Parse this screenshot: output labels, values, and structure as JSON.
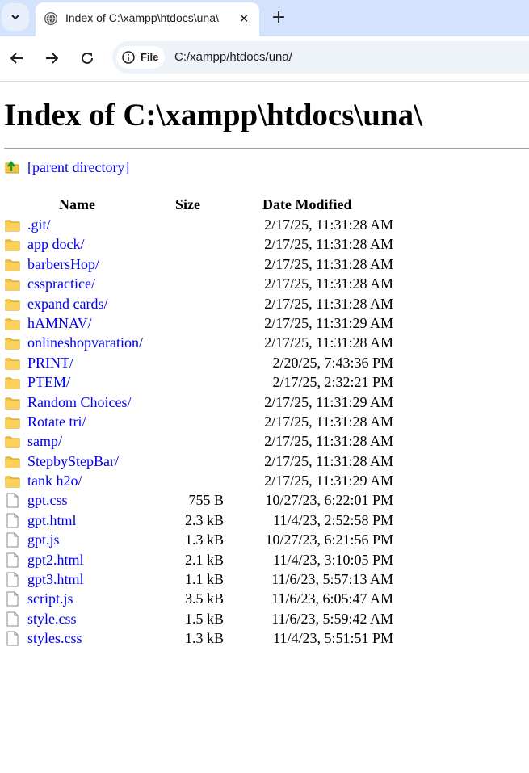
{
  "browser": {
    "tab_title": "Index of C:\\xampp\\htdocs\\una\\",
    "chip_label": "File",
    "url": "C:/xampp/htdocs/una/"
  },
  "page": {
    "title": "Index of C:\\xampp\\htdocs\\una\\",
    "parent_link": "[parent directory]",
    "headers": {
      "name": "Name",
      "size": "Size",
      "date": "Date Modified"
    },
    "entries": [
      {
        "type": "folder",
        "name": ".git/",
        "size": "",
        "date": "2/17/25, 11:31:28 AM"
      },
      {
        "type": "folder",
        "name": "app dock/",
        "size": "",
        "date": "2/17/25, 11:31:28 AM"
      },
      {
        "type": "folder",
        "name": "barbersHop/",
        "size": "",
        "date": "2/17/25, 11:31:28 AM"
      },
      {
        "type": "folder",
        "name": "csspractice/",
        "size": "",
        "date": "2/17/25, 11:31:28 AM"
      },
      {
        "type": "folder",
        "name": "expand cards/",
        "size": "",
        "date": "2/17/25, 11:31:28 AM"
      },
      {
        "type": "folder",
        "name": "hAMNAV/",
        "size": "",
        "date": "2/17/25, 11:31:29 AM"
      },
      {
        "type": "folder",
        "name": "onlineshopvaration/",
        "size": "",
        "date": "2/17/25, 11:31:28 AM"
      },
      {
        "type": "folder",
        "name": "PRINT/",
        "size": "",
        "date": "2/20/25, 7:43:36 PM"
      },
      {
        "type": "folder",
        "name": "PTEM/",
        "size": "",
        "date": "2/17/25, 2:32:21 PM"
      },
      {
        "type": "folder",
        "name": "Random Choices/",
        "size": "",
        "date": "2/17/25, 11:31:29 AM"
      },
      {
        "type": "folder",
        "name": "Rotate tri/",
        "size": "",
        "date": "2/17/25, 11:31:28 AM"
      },
      {
        "type": "folder",
        "name": "samp/",
        "size": "",
        "date": "2/17/25, 11:31:28 AM"
      },
      {
        "type": "folder",
        "name": "StepbyStepBar/",
        "size": "",
        "date": "2/17/25, 11:31:28 AM"
      },
      {
        "type": "folder",
        "name": "tank h2o/",
        "size": "",
        "date": "2/17/25, 11:31:29 AM"
      },
      {
        "type": "file",
        "name": "gpt.css",
        "size": "755 B",
        "date": "10/27/23, 6:22:01 PM"
      },
      {
        "type": "file",
        "name": "gpt.html",
        "size": "2.3 kB",
        "date": "11/4/23, 2:52:58 PM"
      },
      {
        "type": "file",
        "name": "gpt.js",
        "size": "1.3 kB",
        "date": "10/27/23, 6:21:56 PM"
      },
      {
        "type": "file",
        "name": "gpt2.html",
        "size": "2.1 kB",
        "date": "11/4/23, 3:10:05 PM"
      },
      {
        "type": "file",
        "name": "gpt3.html",
        "size": "1.1 kB",
        "date": "11/6/23, 5:57:13 AM"
      },
      {
        "type": "file",
        "name": "script.js",
        "size": "3.5 kB",
        "date": "11/6/23, 6:05:47 AM"
      },
      {
        "type": "file",
        "name": "style.css",
        "size": "1.5 kB",
        "date": "11/6/23, 5:59:42 AM"
      },
      {
        "type": "file",
        "name": "styles.css",
        "size": "1.3 kB",
        "date": "11/4/23, 5:51:51 PM"
      }
    ]
  },
  "colors": {
    "link": "#0000ee",
    "tabbar": "#d3e3fd",
    "folder": "#f5c542"
  }
}
